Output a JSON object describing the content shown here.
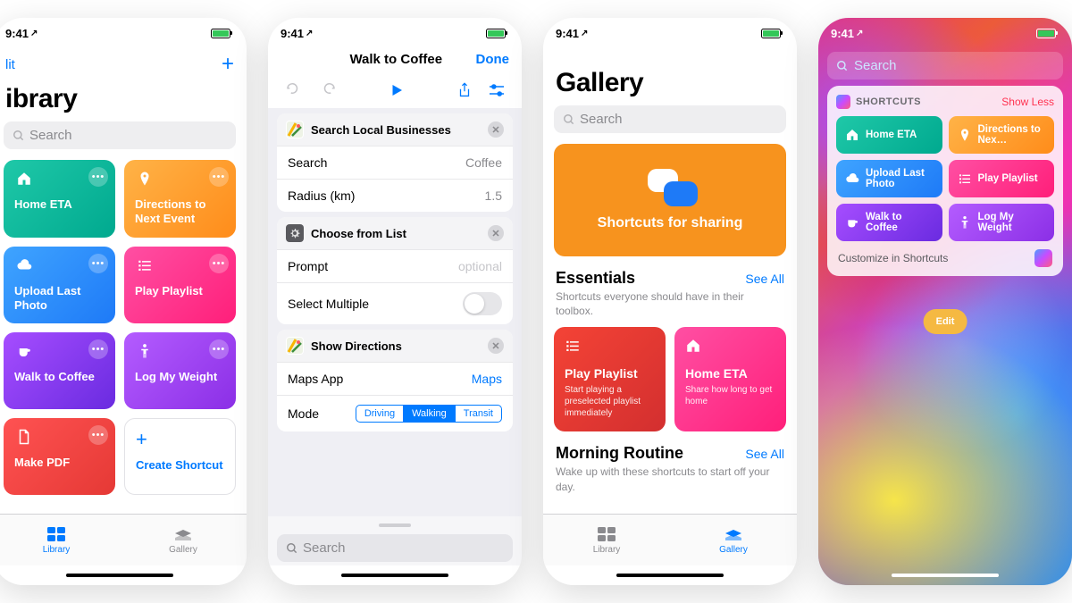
{
  "status": {
    "time": "9:41",
    "loc_arrow": "➤"
  },
  "screen1": {
    "edit": "Edit",
    "edit_abbrev": "lit",
    "title_full": "Library",
    "title": "ibrary",
    "search_placeholder": "Search",
    "tiles": [
      {
        "label": "Home ETA",
        "grad": "g-teal",
        "icon": "home"
      },
      {
        "label": "Directions to Next Event",
        "grad": "g-orange",
        "icon": "pin"
      },
      {
        "label": "Upload Last Photo",
        "grad": "g-blue",
        "icon": "cloud"
      },
      {
        "label": "Play Playlist",
        "grad": "g-pink",
        "icon": "list"
      },
      {
        "label": "Walk to Coffee",
        "grad": "g-purple",
        "icon": "cup"
      },
      {
        "label": "Log My Weight",
        "grad": "g-violet",
        "icon": "body"
      },
      {
        "label": "Make PDF",
        "grad": "g-red",
        "icon": "doc"
      }
    ],
    "create": "Create Shortcut",
    "tab_library": "Library",
    "tab_gallery": "Gallery"
  },
  "screen2": {
    "title": "Walk to Coffee",
    "done": "Done",
    "actions": [
      {
        "name": "Search Local Businesses",
        "icon": "maps",
        "rows": [
          {
            "label": "Search",
            "value": "Coffee"
          },
          {
            "label": "Radius (km)",
            "value": "1.5"
          }
        ]
      },
      {
        "name": "Choose from List",
        "icon": "gear",
        "rows": [
          {
            "label": "Prompt",
            "value": "optional",
            "faded": true
          },
          {
            "label": "Select Multiple",
            "toggle": true
          }
        ]
      },
      {
        "name": "Show Directions",
        "icon": "maps",
        "rows": [
          {
            "label": "Maps App",
            "value": "Maps",
            "blue": true
          },
          {
            "label": "Mode",
            "segmented": [
              "Driving",
              "Walking",
              "Transit"
            ],
            "selected": 1
          }
        ]
      }
    ],
    "search_placeholder": "Search"
  },
  "screen3": {
    "title": "Gallery",
    "search_placeholder": "Search",
    "banner": "Shortcuts for sharing",
    "essentials": {
      "title": "Essentials",
      "see": "See All",
      "desc": "Shortcuts everyone should have in their toolbox.",
      "cards": [
        {
          "title": "Play Playlist",
          "desc": "Start playing a preselected playlist immediately",
          "grad": "g-red2",
          "icon": "list"
        },
        {
          "title": "Home ETA",
          "desc": "Share how long to get home",
          "grad": "g-hotpink",
          "icon": "home"
        }
      ]
    },
    "morning": {
      "title": "Morning Routine",
      "see": "See All",
      "desc": "Wake up with these shortcuts to start off your day."
    },
    "tab_library": "Library",
    "tab_gallery": "Gallery"
  },
  "screen4": {
    "search_placeholder": "Search",
    "panel_title": "SHORTCUTS",
    "show": "Show Less",
    "tiles": [
      {
        "label": "Home ETA",
        "grad": "g-teal",
        "icon": "home"
      },
      {
        "label": "Directions to Nex…",
        "grad": "g-orange",
        "icon": "pin"
      },
      {
        "label": "Upload Last Photo",
        "grad": "g-blue",
        "icon": "cloud"
      },
      {
        "label": "Play Playlist",
        "grad": "g-pink",
        "icon": "list"
      },
      {
        "label": "Walk to Coffee",
        "grad": "g-purple",
        "icon": "cup"
      },
      {
        "label": "Log My Weight",
        "grad": "g-violet",
        "icon": "body"
      }
    ],
    "customize": "Customize in Shortcuts",
    "edit": "Edit"
  }
}
